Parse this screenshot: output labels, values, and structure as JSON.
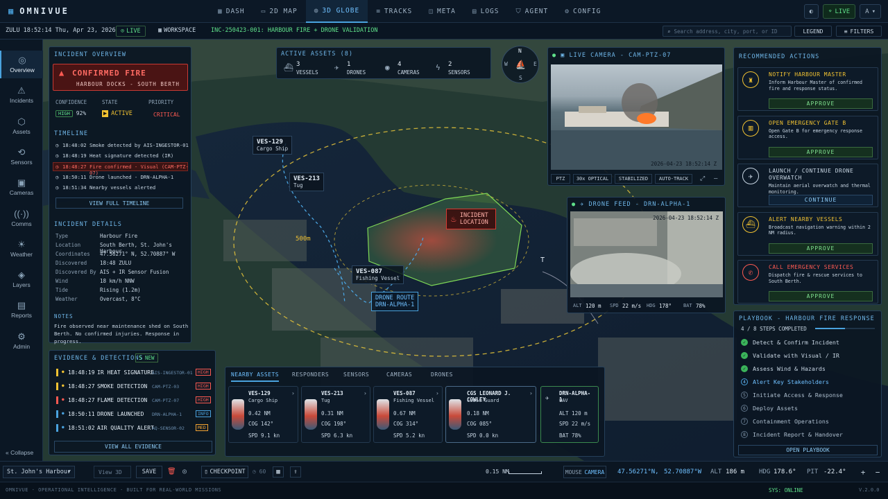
{
  "app": {
    "name": "OMNIVUE"
  },
  "nav": [
    {
      "icon": "▦",
      "label": "DASH"
    },
    {
      "icon": "▭",
      "label": "2D MAP"
    },
    {
      "icon": "◍",
      "label": "3D GLOBE",
      "active": true
    },
    {
      "icon": "≡",
      "label": "TRACKS"
    },
    {
      "icon": "◫",
      "label": "META"
    },
    {
      "icon": "▤",
      "label": "LOGS"
    },
    {
      "icon": "⛉",
      "label": "AGENT"
    },
    {
      "icon": "⚙",
      "label": "CONFIG"
    }
  ],
  "top_right": {
    "live": "LIVE",
    "lang": "A"
  },
  "subbar": {
    "clock": "ZULU 18:52:14 Thu, Apr 23, 2026",
    "live": "LIVE",
    "workspace": "WORKSPACE",
    "incident": "INC-250423-001: HARBOUR FIRE + DRONE VALIDATION",
    "search_placeholder": "Search address, city, port, or ID",
    "legend": "LEGEND",
    "filters": "FILTERS"
  },
  "sidebar": [
    {
      "icon": "◎",
      "label": "Overview",
      "active": true
    },
    {
      "icon": "⚠",
      "label": "Incidents"
    },
    {
      "icon": "⬡",
      "label": "Assets"
    },
    {
      "icon": "⟲",
      "label": "Sensors"
    },
    {
      "icon": "▣",
      "label": "Cameras"
    },
    {
      "icon": "((·))",
      "label": "Comms"
    },
    {
      "icon": "☀",
      "label": "Weather"
    },
    {
      "icon": "◈",
      "label": "Layers"
    },
    {
      "icon": "▤",
      "label": "Reports"
    },
    {
      "icon": "⚙",
      "label": "Admin"
    }
  ],
  "collapse": "Collapse",
  "incident_overview": {
    "title": "INCIDENT OVERVIEW",
    "alert_title": "CONFIRMED FIRE",
    "alert_sub": "HARBOUR DOCKS - SOUTH BERTH",
    "confidence_label": "CONFIDENCE",
    "confidence_tag": "HIGH",
    "confidence_value": "92%",
    "state_label": "STATE",
    "state_value": "ACTIVE",
    "priority_label": "PRIORITY",
    "priority_value": "CRITICAL",
    "timeline_title": "TIMELINE",
    "timeline": [
      {
        "time": "18:48:02",
        "text": "Smoke detected by AIS-INGESTOR-01"
      },
      {
        "time": "18:48:19",
        "text": "Heat signature detected (IR)"
      },
      {
        "time": "18:48:27",
        "text": "Fire confirmed - Visual (CAM-PTZ-07)",
        "alert": true
      },
      {
        "time": "18:50:11",
        "text": "Drone launched - DRN-ALPHA-1"
      },
      {
        "time": "18:51:34",
        "text": "Nearby vessels alerted"
      }
    ],
    "view_timeline": "VIEW FULL TIMELINE",
    "details_title": "INCIDENT DETAILS",
    "details": [
      {
        "k": "Type",
        "v": "Harbour Fire"
      },
      {
        "k": "Location",
        "v": "South Berth, St. John's Harbour"
      },
      {
        "k": "Coordinates",
        "v": "47.56271° N, 52.70887° W"
      },
      {
        "k": "Discovered",
        "v": "18:48 ZULU"
      },
      {
        "k": "Discovered By",
        "v": "AIS + IR Sensor Fusion"
      },
      {
        "k": "Wind",
        "v": "18 km/h NNW"
      },
      {
        "k": "Tide",
        "v": "Rising (1.2m)"
      },
      {
        "k": "Weather",
        "v": "Overcast, 8°C"
      }
    ],
    "notes_title": "NOTES",
    "notes": "Fire observed near maintenance shed on South Berth. No confirmed injuries. Response in progress."
  },
  "evidence": {
    "title": "EVIDENCE & DETECTIONS",
    "new_badge": "5 NEW",
    "items": [
      {
        "time": "18:48:19",
        "label": "IR HEAT SIGNATURE",
        "source": "AIS-INGESTOR-01",
        "level": "HIGH",
        "color": "#f1c232"
      },
      {
        "time": "18:48:27",
        "label": "SMOKE DETECTION",
        "source": "CAM-PTZ-03",
        "level": "HIGH",
        "color": "#f1c232"
      },
      {
        "time": "18:48:27",
        "label": "FLAME DETECTION",
        "source": "CAM-PTZ-07",
        "level": "HIGH",
        "color": "#ff5a52"
      },
      {
        "time": "18:50:11",
        "label": "DRONE LAUNCHED",
        "source": "DRN-ALPHA-1",
        "level": "INFO",
        "color": "#4aa3df"
      },
      {
        "time": "18:51:02",
        "label": "AIR QUALITY ALERT",
        "source": "AQ-SENSOR-02",
        "level": "MED",
        "color": "#4aa3df"
      }
    ],
    "view_all": "VIEW ALL EVIDENCE"
  },
  "active_assets": {
    "title": "ACTIVE ASSETS (8)",
    "stats": [
      {
        "icon": "⛴",
        "count": "3",
        "label": "VESSELS"
      },
      {
        "icon": "✈",
        "count": "1",
        "label": "DRONES"
      },
      {
        "icon": "◉",
        "count": "4",
        "label": "CAMERAS"
      },
      {
        "icon": "ϟ",
        "count": "2",
        "label": "SENSORS"
      }
    ]
  },
  "compass": {
    "n": "N",
    "s": "S",
    "e": "E",
    "w": "W"
  },
  "map_labels": {
    "ves129_id": "VES-129",
    "ves129_type": "Cargo Ship",
    "ves213_id": "VES-213",
    "ves213_type": "Tug",
    "ves087_id": "VES-087",
    "ves087_type": "Fishing Vessel",
    "incident1": "INCIDENT",
    "incident2": "LOCATION",
    "range": "500m",
    "route1": "DRONE ROUTE",
    "route2": "DRN-ALPHA-1",
    "t": "T"
  },
  "live_camera": {
    "title": "LIVE CAMERA - CAM-PTZ-07",
    "timestamp": "2026-04-23 18:52:14 Z",
    "buttons": [
      "PTZ",
      "30x OPTICAL",
      "STABILIZED",
      "AUTO-TRACK"
    ]
  },
  "drone_feed": {
    "title": "DRONE FEED - DRN-ALPHA-1",
    "timestamp": "2026-04-23 18:52:14 Z",
    "stats": [
      {
        "k": "ALT",
        "v": "120 m"
      },
      {
        "k": "SPD",
        "v": "22 m/s"
      },
      {
        "k": "HDG",
        "v": "178°"
      },
      {
        "k": "BAT",
        "v": "78%"
      }
    ]
  },
  "recommended": {
    "title": "RECOMMENDED ACTIONS",
    "actions": [
      {
        "icon": "♜",
        "title": "NOTIFY HARBOUR MASTER",
        "desc": "Inform Harbour Master of confirmed fire and response status.",
        "button": "APPROVE",
        "color": "#f1c232",
        "primary": true
      },
      {
        "icon": "▥",
        "title": "OPEN EMERGENCY GATE B",
        "desc": "Open Gate B for emergency response access.",
        "button": "APPROVE",
        "color": "#f1c232",
        "primary": true
      },
      {
        "icon": "✈",
        "title": "LAUNCH / CONTINUE DRONE OVERWATCH",
        "desc": "Maintain aerial overwatch and thermal monitoring.",
        "button": "CONTINUE",
        "color": "#c8d6e3",
        "primary": false
      },
      {
        "icon": "⛴",
        "title": "ALERT NEARBY VESSELS",
        "desc": "Broadcast navigation warning within 2 NM radius.",
        "button": "APPROVE",
        "color": "#f1c232",
        "primary": true
      },
      {
        "icon": "✆",
        "title": "CALL EMERGENCY SERVICES",
        "desc": "Dispatch fire & rescue services to South Berth.",
        "button": "APPROVE",
        "color": "#ff5a52",
        "primary": true
      }
    ]
  },
  "playbook": {
    "title": "PLAYBOOK - HARBOUR FIRE RESPONSE",
    "progress_text": "4 / 8 STEPS COMPLETED",
    "progress": 0.5,
    "steps": [
      {
        "n": "✓",
        "label": "Detect & Confirm Incident",
        "state": "done"
      },
      {
        "n": "✓",
        "label": "Validate with Visual / IR",
        "state": "done"
      },
      {
        "n": "✓",
        "label": "Assess Wind & Hazards",
        "state": "done"
      },
      {
        "n": "4",
        "label": "Alert Key Stakeholders",
        "state": "current"
      },
      {
        "n": "5",
        "label": "Initiate Access & Response",
        "state": "todo"
      },
      {
        "n": "6",
        "label": "Deploy Assets",
        "state": "todo"
      },
      {
        "n": "7",
        "label": "Containment Operations",
        "state": "todo"
      },
      {
        "n": "8",
        "label": "Incident Report & Handover",
        "state": "todo"
      }
    ],
    "open": "OPEN PLAYBOOK"
  },
  "nearby": {
    "tabs": [
      "NEARBY ASSETS",
      "RESPONDERS",
      "SENSORS",
      "CAMERAS",
      "DRONES"
    ],
    "cards": [
      {
        "id": "VES-129",
        "type": "Cargo Ship",
        "l1": "0.42 NM",
        "l2": "COG 142°",
        "l3": "SPD 9.1 kn"
      },
      {
        "id": "VES-213",
        "type": "Tug",
        "l1": "0.31 NM",
        "l2": "COG 198°",
        "l3": "SPD 6.3 kn"
      },
      {
        "id": "VES-087",
        "type": "Fishing Vessel",
        "l1": "0.67 NM",
        "l2": "COG 314°",
        "l3": "SPD 5.2 kn"
      },
      {
        "id": "CGS LEONARD J. COWLEY",
        "type": "Coast Guard",
        "l1": "0.18 NM",
        "l2": "COG 085°",
        "l3": "SPD 0.0 kn"
      },
      {
        "id": "DRN-ALPHA-1",
        "type": "UAV",
        "l1": "ALT 120 m",
        "l2": "SPD 22 m/s",
        "l3": "BAT 78%"
      }
    ]
  },
  "bottombar": {
    "location": "St. John's Harbour",
    "view": "View 3D",
    "save": "SAVE",
    "checkpoint": "CHECKPOINT",
    "count": "60",
    "scale": "0.15 NM",
    "mouse": "MOUSE",
    "camera": "CAMERA",
    "lat": "47.56271°N,",
    "lon": "52.70887°W",
    "alt_label": "ALT",
    "alt": "186 m",
    "hdg_label": "HDG",
    "hdg": "178.6°",
    "pit_label": "PIT",
    "pit": "-22.4°"
  },
  "footer": {
    "left": "OMNIVUE · OPERATIONAL INTELLIGENCE · BUILT FOR REAL-WORLD MISSIONS",
    "sys": "SYS: ONLINE",
    "version": "V.2.0.0"
  }
}
